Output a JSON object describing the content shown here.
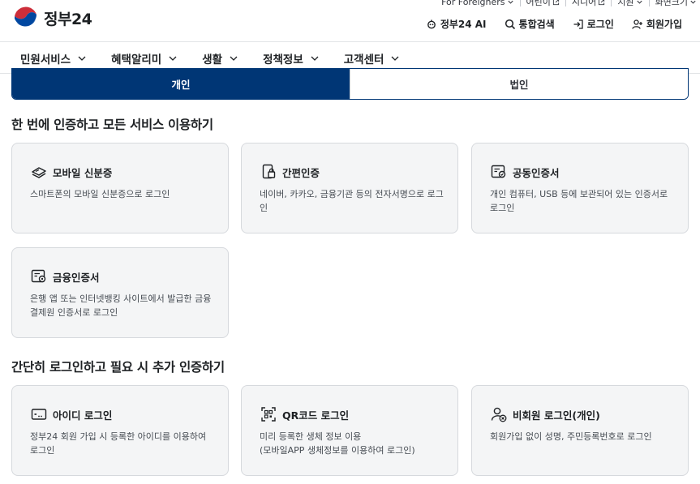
{
  "header": {
    "logo_text": "정부24",
    "utils": [
      {
        "label": "For Foreigners",
        "icon": "chevron-down-icon"
      },
      {
        "label": "어린이",
        "icon": "external-link-icon"
      },
      {
        "label": "시니어",
        "icon": "external-link-icon"
      },
      {
        "label": "지원",
        "icon": "chevron-down-icon"
      },
      {
        "label": "화면크기",
        "icon": "chevron-down-icon"
      }
    ],
    "actions": [
      {
        "label": "정부24 AI",
        "icon": "ai-icon"
      },
      {
        "label": "통합검색",
        "icon": "search-icon"
      },
      {
        "label": "로그인",
        "icon": "login-icon"
      },
      {
        "label": "회원가입",
        "icon": "user-plus-icon"
      }
    ]
  },
  "nav": {
    "items": [
      {
        "label": "민원서비스"
      },
      {
        "label": "혜택알리미"
      },
      {
        "label": "생활"
      },
      {
        "label": "정책정보"
      },
      {
        "label": "고객센터"
      }
    ]
  },
  "tabs": [
    {
      "label": "개인",
      "active": true
    },
    {
      "label": "법인",
      "active": false
    }
  ],
  "sections": [
    {
      "title": "한 번에 인증하고 모든 서비스 이용하기",
      "cards": [
        {
          "title": "모바일 신분증",
          "desc": "스마트폰의 모바일 신분증으로 로그인",
          "icon": "mobile-id-icon"
        },
        {
          "title": "간편인증",
          "desc": "네이버, 카카오, 금융기관 등의 전자서명으로 로그인",
          "icon": "simple-auth-icon"
        },
        {
          "title": "공동인증서",
          "desc": "개인 컴퓨터, USB 등에 보관되어 있는 인증서로 로그인",
          "icon": "joint-certificate-icon"
        },
        {
          "title": "금융인증서",
          "desc": "은행 앱 또는 인터넷뱅킹 사이트에서 발급한 금융결제원 인증서로 로그인",
          "icon": "financial-certificate-icon"
        }
      ]
    },
    {
      "title": "간단히 로그인하고 필요 시 추가 인증하기",
      "cards": [
        {
          "title": "아이디 로그인",
          "desc": "정부24 회원 가입 시 등록한 아이디를 이용하여 로그인",
          "icon": "id-login-icon"
        },
        {
          "title": "QR코드 로그인",
          "desc_lines": [
            "미리 등록한 생체 정보 이용",
            "(모바일APP 생체정보를 이용하여 로그인)"
          ],
          "icon": "qr-code-icon"
        },
        {
          "title": "비회원 로그인(개인)",
          "desc": "회원가입 없이 성명, 주민등록번호로 로그인",
          "icon": "non-member-icon"
        }
      ]
    }
  ],
  "colors": {
    "primary": "#003675",
    "card_bg": "#f4f5f6",
    "border": "#d6d9dd"
  }
}
